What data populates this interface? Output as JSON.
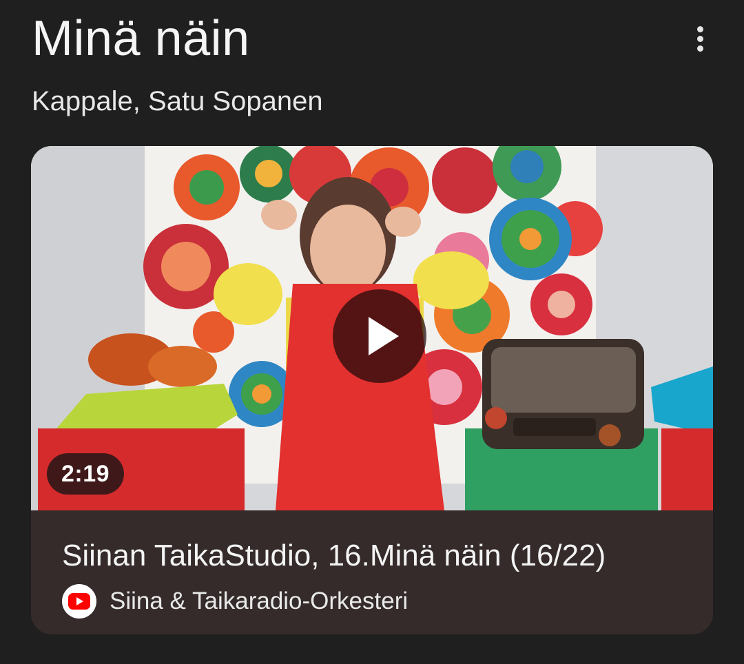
{
  "header": {
    "title": "Minä näin",
    "subtitle": "Kappale, Satu Sopanen",
    "more_icon": "more-vert-icon"
  },
  "video": {
    "duration": "2:19",
    "title": "Siinan TaikaStudio, 16.Minä näin (16/22)",
    "channel": "Siina & Taikaradio-Orkesteri",
    "source_icon": "youtube-icon",
    "play_icon": "play-icon"
  },
  "colors": {
    "background": "#1f1f1f",
    "card": "#352b2b",
    "youtube_red": "#ff0000"
  }
}
